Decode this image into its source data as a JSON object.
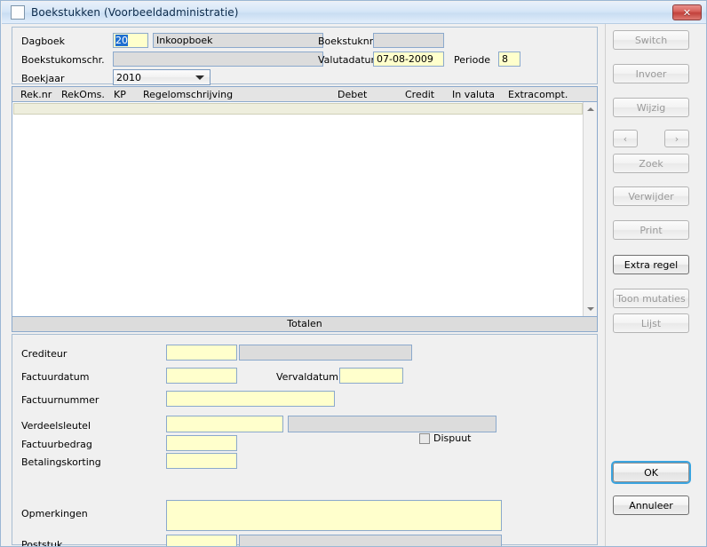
{
  "window": {
    "title": "Boekstukken (Voorbeeldadministratie)",
    "icon": "window-icon",
    "close_label": "✕"
  },
  "header": {
    "fields": [
      {
        "label": "Dagboek",
        "value": "20",
        "kind": "input-selected"
      },
      {
        "label": "",
        "value": "Inkoopboek",
        "kind": "readonly"
      },
      {
        "label": "Boekstukomschr.",
        "value": "",
        "kind": "readonly"
      },
      {
        "label": "Boekjaar",
        "value": "2010",
        "kind": "combo"
      },
      {
        "label": "Boekstuknr.",
        "value": "",
        "kind": "readonly"
      },
      {
        "label": "Valutadatum",
        "value": "07-08-2009",
        "kind": "input"
      },
      {
        "label": "Periode",
        "value": "8",
        "kind": "input"
      }
    ]
  },
  "grid": {
    "columns": [
      "Rek.nr",
      "RekOms.",
      "KP",
      "Regelomschrijving",
      "Debet",
      "Credit",
      "In valuta",
      "Extracompt."
    ],
    "rows": []
  },
  "totals": {
    "label": "Totalen"
  },
  "form": {
    "crediteur_label": "Crediteur",
    "crediteur_value": "",
    "crediteur_desc": "",
    "factuurdatum_label": "Factuurdatum",
    "factuurdatum_value": "",
    "vervaldatum_label": "Vervaldatum",
    "vervaldatum_value": "",
    "factuurnummer_label": "Factuurnummer",
    "factuurnummer_value": "",
    "verdeelsleutel_label": "Verdeelsleutel",
    "verdeelsleutel_value": "",
    "verdeelsleutel_desc": "",
    "factuurbedrag_label": "Factuurbedrag",
    "factuurbedrag_value": "",
    "betalingskorting_label": "Betalingskorting",
    "betalingskorting_value": "",
    "dispuut_label": "Dispuut",
    "dispuut_checked": false,
    "opmerkingen_label": "Opmerkingen",
    "opmerkingen_value": "",
    "poststuk_label": "Poststuk",
    "poststuk_value": "",
    "poststuk_desc": ""
  },
  "buttons": {
    "switch": "Switch",
    "invoer": "Invoer",
    "wijzig": "Wijzig",
    "prev": "‹",
    "next": "›",
    "zoek": "Zoek",
    "verwijder": "Verwijder",
    "print": "Print",
    "extra_regel": "Extra regel",
    "toon_mutaties": "Toon mutaties",
    "lijst": "Lijst",
    "ok": "OK",
    "annuleer": "Annuleer"
  },
  "colors": {
    "input_yellow": "#ffffcc",
    "readonly_gray": "#dcdcdc",
    "selection_blue": "#1f6fd0",
    "focus_ring": "#3aa4e0",
    "border_blue": "#8ba9cc"
  }
}
